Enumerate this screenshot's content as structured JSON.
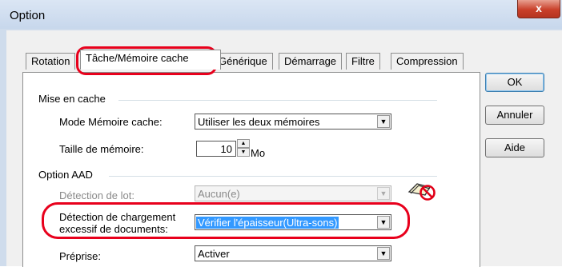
{
  "window": {
    "title": "Option",
    "close_label": "x"
  },
  "tabs": [
    {
      "label": "Rotation"
    },
    {
      "label": "Tâche/Mémoire cache"
    },
    {
      "label": "Générique"
    },
    {
      "label": "Démarrage"
    },
    {
      "label": "Filtre"
    },
    {
      "label": "Compression"
    }
  ],
  "buttons": {
    "ok": "OK",
    "cancel": "Annuler",
    "help": "Aide"
  },
  "cache_group": {
    "title": "Mise en cache",
    "mode_label": "Mode Mémoire cache:",
    "mode_value": "Utiliser les deux mémoires",
    "size_label": "Taille de mémoire:",
    "size_value": "10",
    "size_unit": "Mo"
  },
  "aad_group": {
    "title": "Option AAD",
    "batch_label": "Détection de lot:",
    "batch_value": "Aucun(e)",
    "overload_label_line1": "Détection de chargement",
    "overload_label_line2": "excessif de documents:",
    "overload_value": "Vérifier l'épaisseur(Ultra-sons)",
    "prepick_label": "Préprise:",
    "prepick_value": "Activer"
  },
  "colors": {
    "highlight": "#e8001c",
    "selection": "#3399ff"
  }
}
